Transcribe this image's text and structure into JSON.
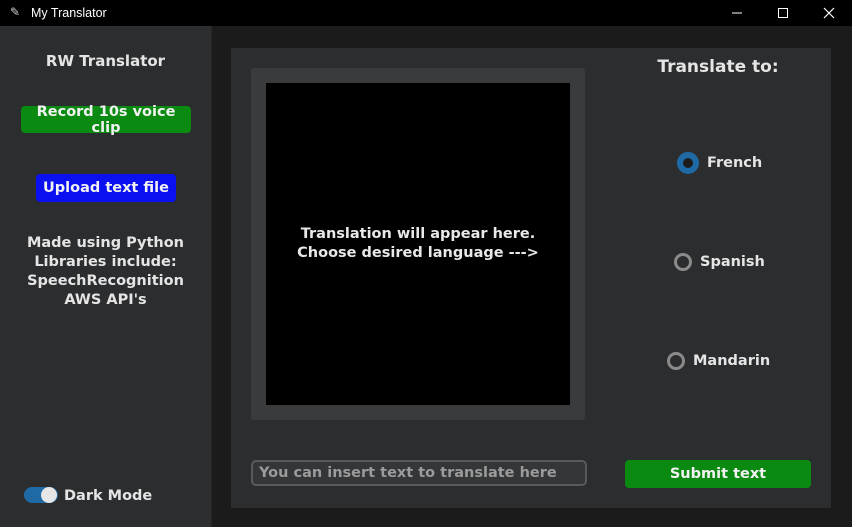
{
  "window": {
    "title": "My Translator",
    "app_icon": "feather-icon"
  },
  "sidebar": {
    "title": "RW Translator",
    "record_label": "Record 10s voice clip",
    "upload_label": "Upload text file",
    "credits": [
      "Made using Python",
      "Libraries include:",
      "SpeechRecognition",
      "AWS API's"
    ],
    "dark_mode_label": "Dark Mode",
    "dark_mode_on": true
  },
  "main": {
    "output_lines": [
      "Translation will appear here.",
      "Choose desired language --->"
    ],
    "input_placeholder": "You can insert text to translate here",
    "input_value": "",
    "submit_label": "Submit text",
    "translate_title": "Translate to:",
    "languages": [
      {
        "label": "French",
        "selected": true
      },
      {
        "label": "Spanish",
        "selected": false
      },
      {
        "label": "Mandarin",
        "selected": false
      }
    ]
  },
  "colors": {
    "green_button": "#0a8a10",
    "blue_button": "#0a10f0",
    "accent": "#1f6aa5",
    "panel": "#2b2d2f",
    "output_bg": "#000000"
  }
}
